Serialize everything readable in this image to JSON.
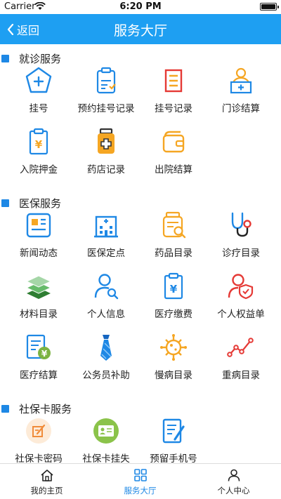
{
  "status_bar": {
    "carrier": "Carrier",
    "time": "6:20 PM"
  },
  "nav": {
    "back_label": "返回",
    "title": "服务大厅"
  },
  "sections": [
    {
      "title": "就诊服务",
      "items": [
        {
          "label": "挂号",
          "icon": "register-icon"
        },
        {
          "label": "预约挂号记录",
          "icon": "appointment-record-icon"
        },
        {
          "label": "挂号记录",
          "icon": "register-record-icon"
        },
        {
          "label": "门诊结算",
          "icon": "outpatient-settlement-icon"
        },
        {
          "label": "入院押金",
          "icon": "admission-deposit-icon"
        },
        {
          "label": "药店记录",
          "icon": "pharmacy-record-icon"
        },
        {
          "label": "出院结算",
          "icon": "discharge-settlement-icon"
        }
      ]
    },
    {
      "title": "医保服务",
      "items": [
        {
          "label": "新闻动态",
          "icon": "news-icon"
        },
        {
          "label": "医保定点",
          "icon": "hospital-icon"
        },
        {
          "label": "药品目录",
          "icon": "drug-catalog-icon"
        },
        {
          "label": "诊疗目录",
          "icon": "stethoscope-icon"
        },
        {
          "label": "材料目录",
          "icon": "layers-icon"
        },
        {
          "label": "个人信息",
          "icon": "person-search-icon"
        },
        {
          "label": "医疗缴费",
          "icon": "medical-payment-icon"
        },
        {
          "label": "个人权益单",
          "icon": "person-shield-icon"
        },
        {
          "label": "医疗结算",
          "icon": "medical-settlement-icon"
        },
        {
          "label": "公务员补助",
          "icon": "tie-icon"
        },
        {
          "label": "慢病目录",
          "icon": "virus-icon"
        },
        {
          "label": "重病目录",
          "icon": "trend-line-icon"
        }
      ]
    },
    {
      "title": "社保卡服务",
      "items": [
        {
          "label": "社保卡密码",
          "icon": "card-password-icon"
        },
        {
          "label": "社保卡挂失",
          "icon": "card-loss-icon"
        },
        {
          "label": "预留手机号",
          "icon": "reserved-phone-icon"
        }
      ]
    }
  ],
  "tabs": [
    {
      "label": "我的主页",
      "icon": "home-icon",
      "active": false
    },
    {
      "label": "服务大厅",
      "icon": "grid-icon",
      "active": true
    },
    {
      "label": "个人中心",
      "icon": "person-icon",
      "active": false
    }
  ],
  "colors": {
    "accent": "#1e9ff2",
    "icon_blue": "#1e88e5",
    "icon_orange": "#f5a623",
    "icon_red": "#e53935"
  }
}
